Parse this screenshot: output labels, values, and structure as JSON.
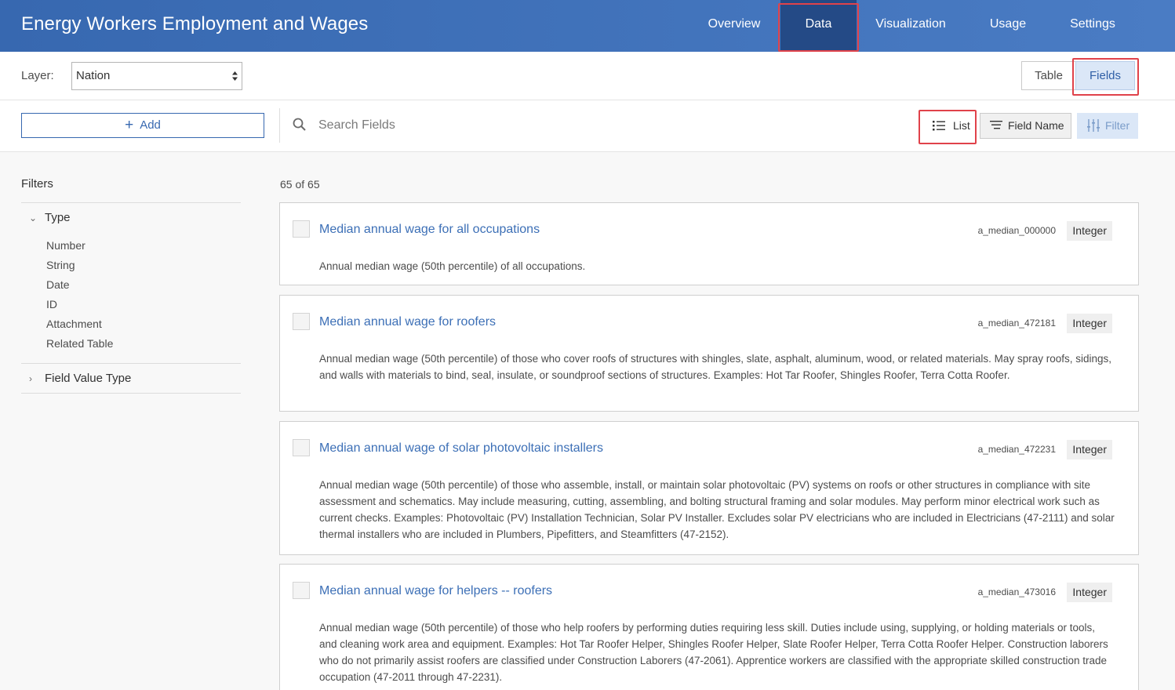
{
  "header": {
    "title": "Energy Workers Employment and Wages",
    "tabs": [
      {
        "label": "Overview"
      },
      {
        "label": "Data"
      },
      {
        "label": "Visualization"
      },
      {
        "label": "Usage"
      },
      {
        "label": "Settings"
      }
    ]
  },
  "layer_bar": {
    "label": "Layer:",
    "selected": "Nation",
    "view_toggle": {
      "table": "Table",
      "fields": "Fields"
    }
  },
  "toolbar": {
    "add_label": "Add",
    "search_placeholder": "Search Fields",
    "list_label": "List",
    "sort_label": "Field Name",
    "filter_label": "Filter"
  },
  "sidebar": {
    "title": "Filters",
    "type_group": {
      "label": "Type",
      "items": [
        "Number",
        "String",
        "Date",
        "ID",
        "Attachment",
        "Related Table"
      ]
    },
    "field_value_type_label": "Field Value Type"
  },
  "content": {
    "count": "65 of 65",
    "fields": [
      {
        "title": "Median annual wage for all occupations",
        "code": "a_median_000000",
        "type": "Integer",
        "description": "Annual median wage (50th percentile) of all occupations."
      },
      {
        "title": "Median annual wage for roofers",
        "code": "a_median_472181",
        "type": "Integer",
        "description": "Annual median wage (50th percentile) of those who cover roofs of structures with shingles, slate, asphalt, aluminum, wood, or related materials. May spray roofs, sidings, and walls with materials to bind, seal, insulate, or soundproof sections of structures. Examples: Hot Tar Roofer, Shingles Roofer, Terra Cotta Roofer."
      },
      {
        "title": "Median annual wage of solar photovoltaic installers",
        "code": "a_median_472231",
        "type": "Integer",
        "description": "Annual median wage (50th percentile) of those who assemble, install, or maintain solar photovoltaic (PV) systems on roofs or other structures in compliance with site assessment and schematics. May include measuring, cutting, assembling, and bolting structural framing and solar modules. May perform minor electrical work such as current checks. Examples: Photovoltaic (PV) Installation Technician, Solar PV Installer. Excludes solar PV electricians who are included in Electricians (47-2111) and solar thermal installers who are included in Plumbers, Pipefitters, and Steamfitters (47-2152)."
      },
      {
        "title": "Median annual wage for helpers -- roofers",
        "code": "a_median_473016",
        "type": "Integer",
        "description": "Annual median wage (50th percentile) of those who help roofers by performing duties requiring less skill. Duties include using, supplying, or holding materials or tools, and cleaning work area and equipment. Examples: Hot Tar Roofer Helper, Shingles Roofer Helper, Slate Roofer Helper, Terra Cotta Roofer Helper. Construction laborers who do not primarily assist roofers are classified under Construction Laborers (47-2061). Apprentice workers are classified with the appropriate skilled construction trade occupation (47-2011 through 47-2231)."
      }
    ]
  },
  "colors": {
    "header": "#3768b0",
    "active_tab": "#244a86",
    "link": "#3c6fb6",
    "highlight": "#e0424a"
  }
}
